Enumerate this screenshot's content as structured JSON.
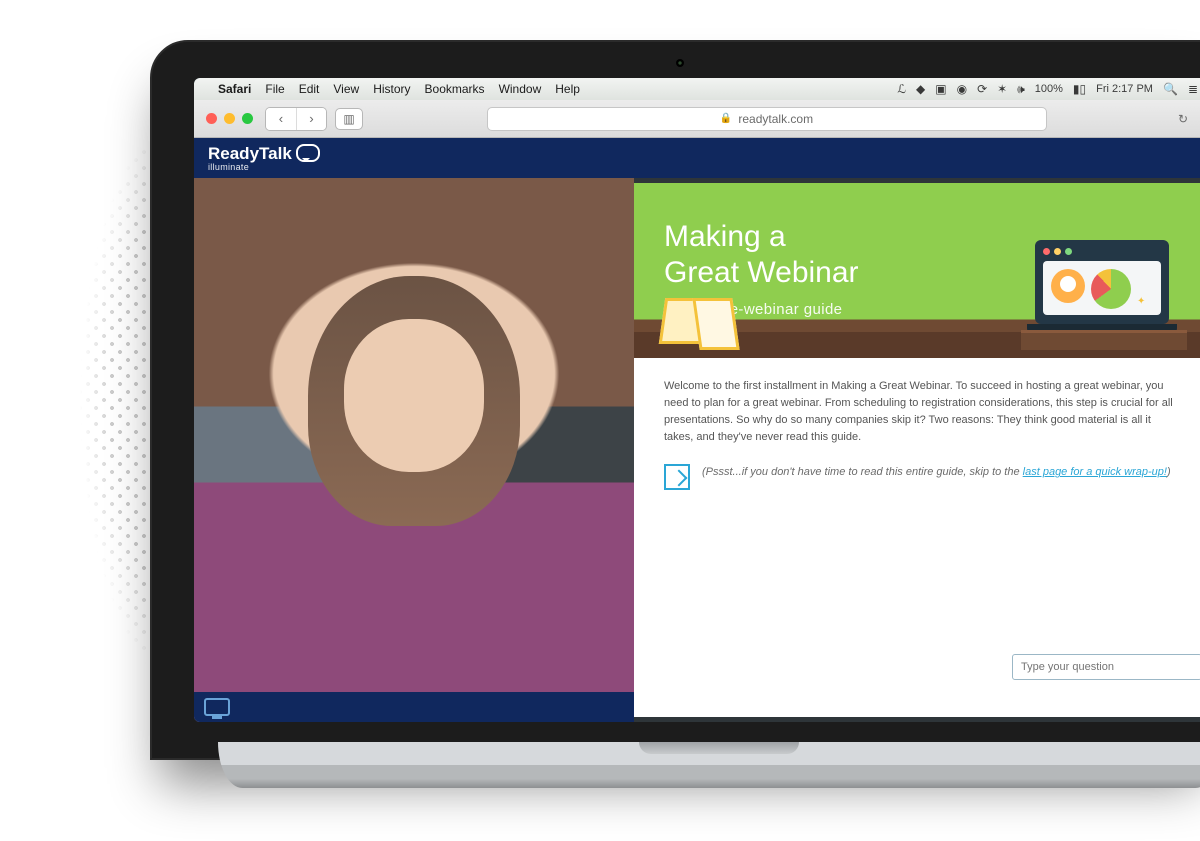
{
  "menubar": {
    "app": "Safari",
    "items": [
      "File",
      "Edit",
      "View",
      "History",
      "Bookmarks",
      "Window",
      "Help"
    ],
    "battery": "100%",
    "clock": "Fri 2:17 PM"
  },
  "safari": {
    "domain": "readytalk.com"
  },
  "readytalk": {
    "brand": "ReadyTalk",
    "brand_sub": "illuminate"
  },
  "slide": {
    "title_line1": "Making a",
    "title_line2": "Great Webinar",
    "subtitle": "Part 1: pre-webinar guide",
    "body": "Welcome to the first installment in Making a Great Webinar. To succeed in hosting a great webinar, you need to plan for a great webinar. From scheduling to registration considerations, this step is crucial for all presentations. So why do so many companies skip it? Two reasons: They think good material is all it takes, and they've never read this guide.",
    "hint_prefix": "(Pssst...if you don't have time to read this entire guide, skip to the ",
    "hint_link": "last page for a quick wrap-up!",
    "hint_suffix": ")"
  },
  "question_placeholder": "Type your question"
}
